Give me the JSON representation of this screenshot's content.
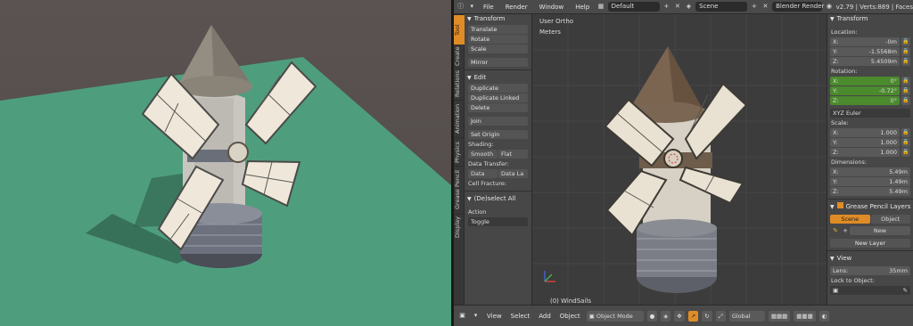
{
  "topbar": {
    "menus": [
      "File",
      "Render",
      "Window",
      "Help"
    ],
    "layout_field": "Default",
    "scene_field": "Scene",
    "engine": "Blender Render",
    "stats": "v2.79 | Verts:889 | Faces"
  },
  "tabs": [
    "Tool",
    "Create",
    "Relations",
    "Animation",
    "Physics",
    "Grease Pencil",
    "Display"
  ],
  "tool_shelf": {
    "transform_title": "Transform",
    "translate": "Translate",
    "rotate": "Rotate",
    "scale": "Scale",
    "mirror": "Mirror",
    "edit_title": "Edit",
    "duplicate": "Duplicate",
    "duplicate_linked": "Duplicate Linked",
    "delete": "Delete",
    "join": "Join",
    "set_origin": "Set Origin",
    "shading_label": "Shading:",
    "smooth": "Smooth",
    "flat": "Flat",
    "data_transfer_label": "Data Transfer:",
    "data": "Data",
    "data_layout": "Data La",
    "cell_fracture_label": "Cell Fracture:",
    "deselect_title": "(De)select All",
    "action_label": "Action",
    "action_value": "Toggle"
  },
  "viewport": {
    "view_name": "User Ortho",
    "units": "Meters",
    "object_name": "(0) WindSails"
  },
  "npanel": {
    "transform_title": "Transform",
    "location_label": "Location:",
    "loc_x": "-0m",
    "loc_y": "-1.5568m",
    "loc_z": "5.4509m",
    "rotation_label": "Rotation:",
    "rot_x": "0°",
    "rot_y": "-0.72°",
    "rot_z": "0°",
    "euler": "XYZ Euler",
    "scale_label": "Scale:",
    "scale_x": "1.000",
    "scale_y": "1.000",
    "scale_z": "1.000",
    "dimensions_label": "Dimensions:",
    "dim_x": "5.49m",
    "dim_y": "1.49m",
    "dim_z": "5.49m",
    "gp_title": "Grease Pencil Layers",
    "gp_scene": "Scene",
    "gp_object": "Object",
    "gp_new": "New",
    "gp_new_layer": "New Layer",
    "view_title": "View",
    "lens_label": "Lens:",
    "lens_value": "35mm",
    "lock_label": "Lock to Object:",
    "axis_x": "X:",
    "axis_y": "Y:",
    "axis_z": "Z:"
  },
  "bottombar": {
    "view": "View",
    "select": "Select",
    "add": "Add",
    "object": "Object",
    "mode": "Object Mode",
    "orientation": "Global"
  },
  "colors": {
    "accent": "#e08c26",
    "panel": "#474747",
    "ground_left": "#4e9e7e",
    "rot_green": "#4c8a2e"
  }
}
